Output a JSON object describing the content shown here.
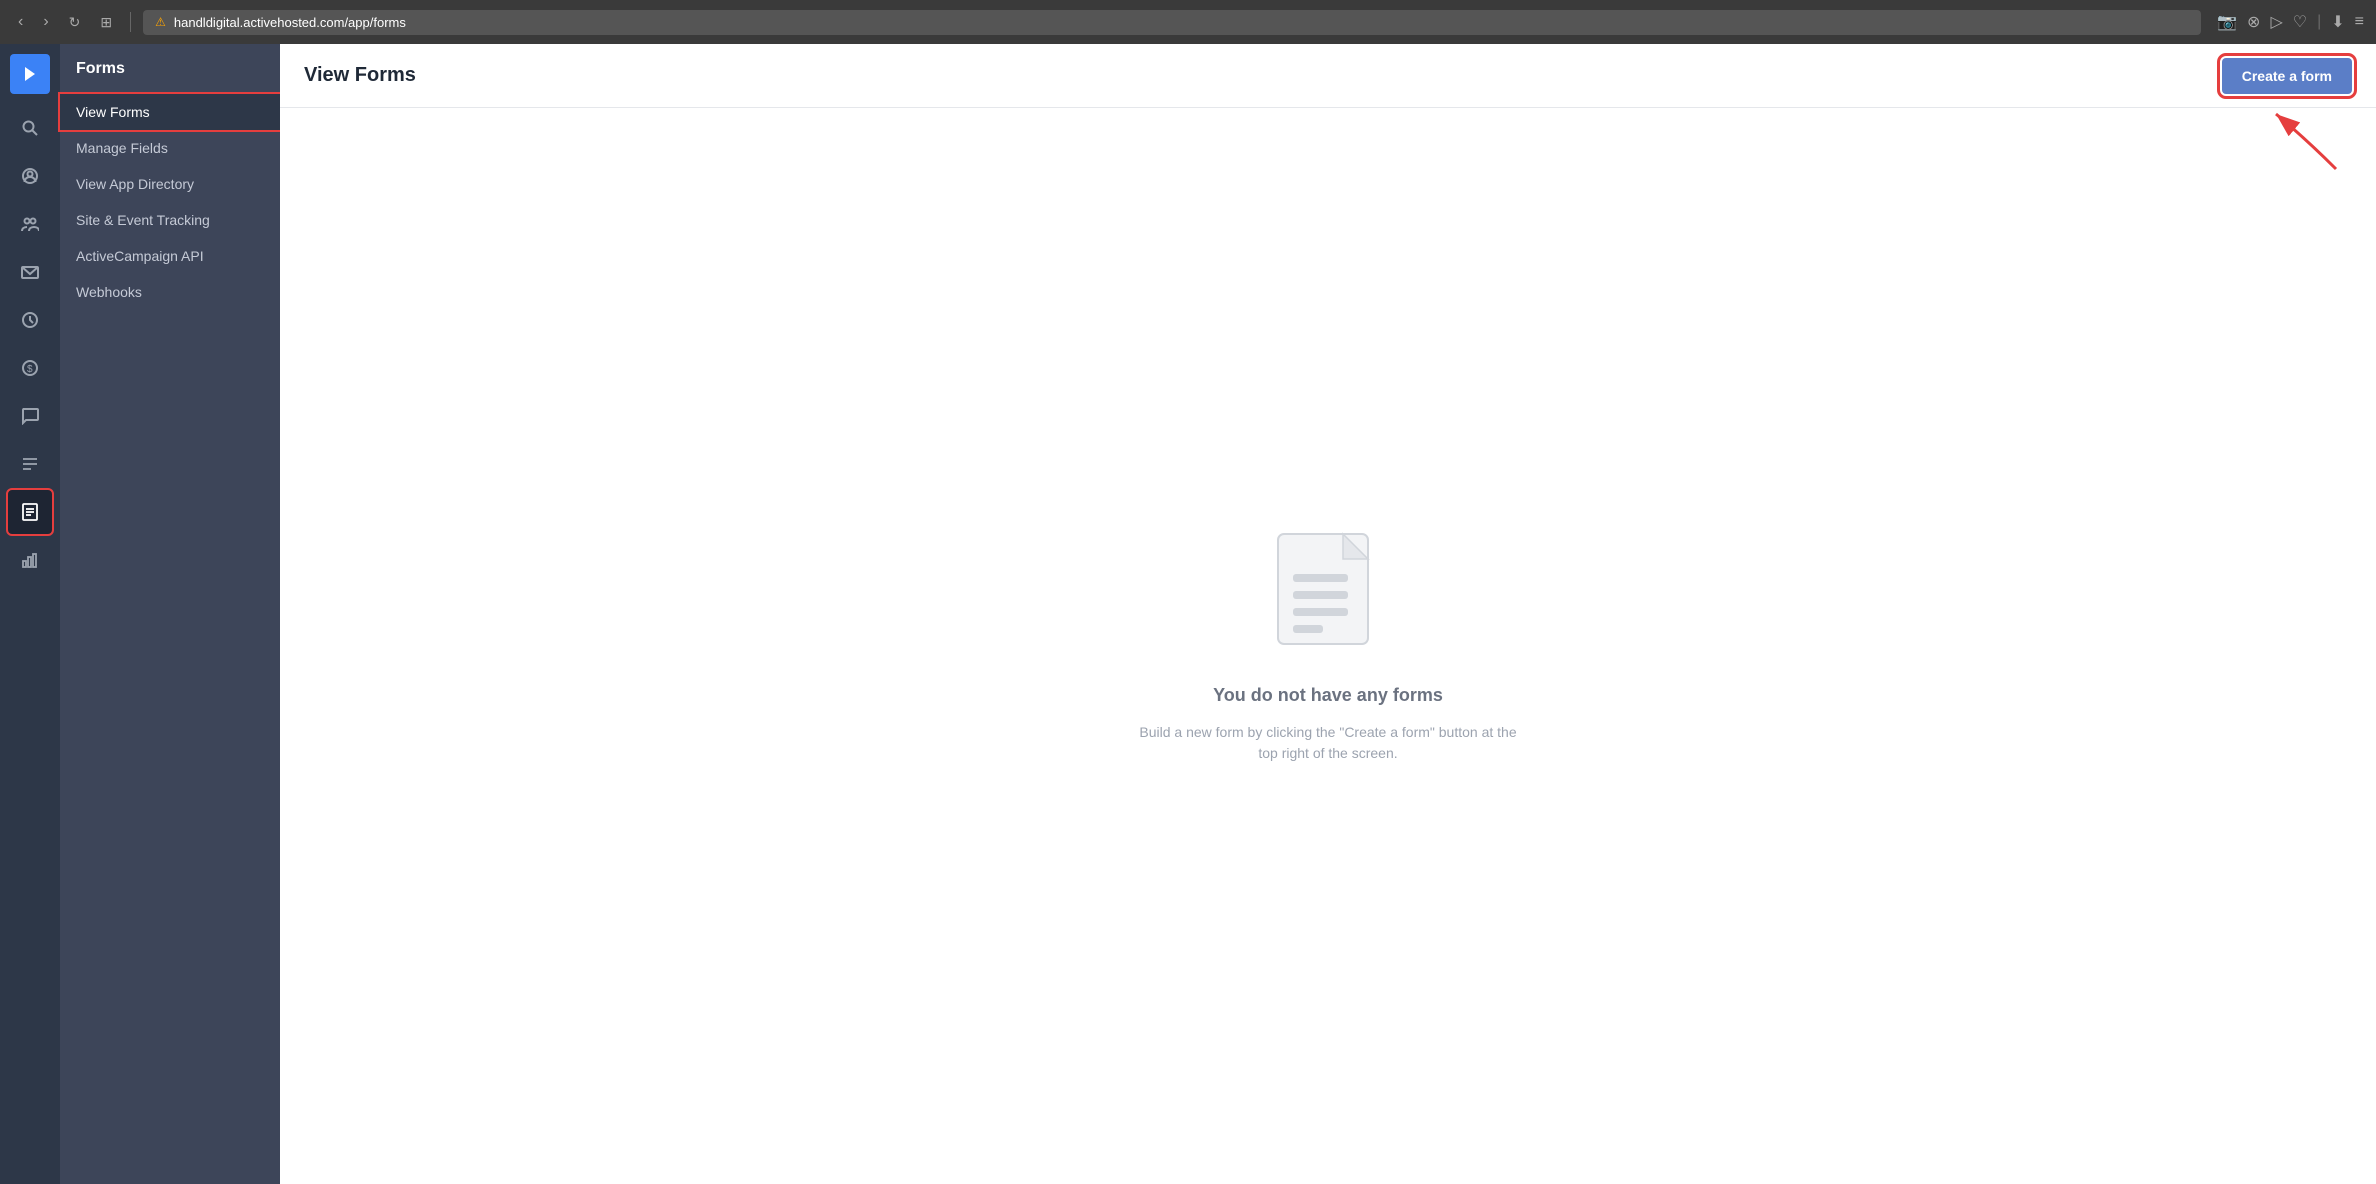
{
  "browser": {
    "url": "handldigital.activehosted.com/app/forms",
    "nav": {
      "back": "‹",
      "forward": "›",
      "reload": "↻",
      "grid": "⊞"
    },
    "right_icons": [
      "📷",
      "⊗",
      "▷",
      "♡",
      "⬇",
      "≡"
    ]
  },
  "sidebar": {
    "title": "Forms",
    "items": [
      {
        "label": "View Forms",
        "active": true
      },
      {
        "label": "Manage Fields",
        "active": false
      },
      {
        "label": "View App Directory",
        "active": false
      },
      {
        "label": "Site & Event Tracking",
        "active": false
      },
      {
        "label": "ActiveCampaign API",
        "active": false
      },
      {
        "label": "Webhooks",
        "active": false
      }
    ]
  },
  "icon_bar": {
    "logo_symbol": "›",
    "items": [
      {
        "icon": "🔍",
        "name": "search-icon"
      },
      {
        "icon": "◎",
        "name": "contacts-icon"
      },
      {
        "icon": "👥",
        "name": "people-icon"
      },
      {
        "icon": "✉",
        "name": "mail-icon"
      },
      {
        "icon": "◷",
        "name": "automations-icon"
      },
      {
        "icon": "$",
        "name": "deals-icon"
      },
      {
        "icon": "💬",
        "name": "conversations-icon"
      },
      {
        "icon": "≡",
        "name": "lists-icon"
      },
      {
        "icon": "📋",
        "name": "forms-icon",
        "active": true
      },
      {
        "icon": "📊",
        "name": "reports-icon"
      }
    ]
  },
  "main": {
    "header_title": "View Forms",
    "create_button_label": "Create a form"
  },
  "empty_state": {
    "title": "You do not have any forms",
    "description": "Build a new form by clicking the \"Create a form\" button at the top right of the screen."
  }
}
